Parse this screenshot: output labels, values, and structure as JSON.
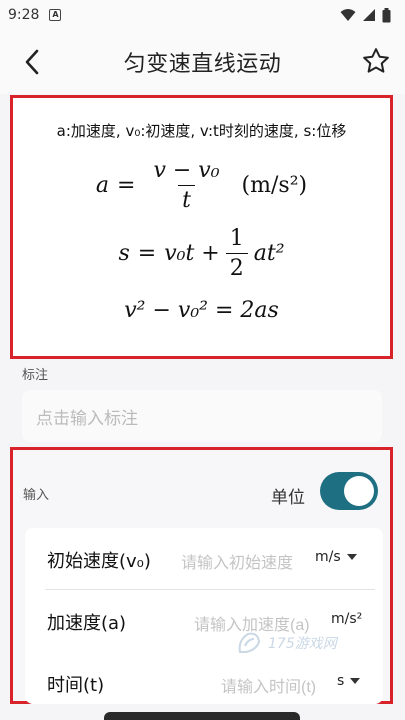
{
  "status_bar": {
    "time": "9:28",
    "notification_letter": "A"
  },
  "nav": {
    "title": "匀变速直线运动"
  },
  "formula_card": {
    "legend": "a:加速度, v₀:初速度, v:t时刻的速度, s:位移",
    "formula1": {
      "lhs": "a",
      "numerator": "v − v₀",
      "denominator": "t",
      "unit": "(m/s²)"
    },
    "formula2": {
      "lhs": "s",
      "term1": "v₀t +",
      "frac_num": "1",
      "frac_den": "2",
      "term2": "at²"
    },
    "formula3": "v² − v₀² = 2as"
  },
  "note": {
    "label": "标注",
    "placeholder": "点击输入标注"
  },
  "input_section": {
    "label": "输入",
    "unit_toggle_label": "单位",
    "unit_toggle_on": true,
    "rows": [
      {
        "label": "初始速度(v₀)",
        "placeholder": "请输入初始速度",
        "unit": "m/s",
        "has_dropdown": true
      },
      {
        "label": "加速度(a)",
        "placeholder": "请输入加速度(a)",
        "unit": "m/s²",
        "has_dropdown": false
      },
      {
        "label": "时间(t)",
        "placeholder": "请输入时间(t)",
        "unit": "s",
        "has_dropdown": true
      }
    ]
  },
  "watermark": {
    "text": "175游戏网"
  },
  "colors": {
    "accent_teal": "#1f6f82",
    "highlight_red": "#d8232a"
  }
}
